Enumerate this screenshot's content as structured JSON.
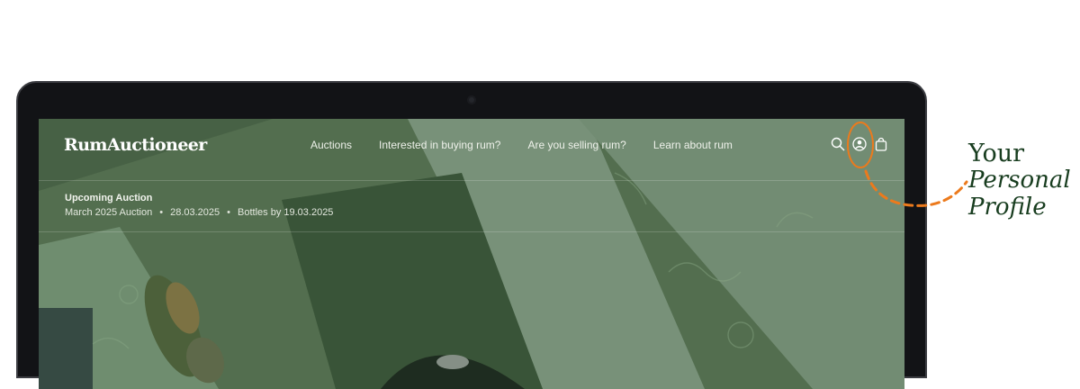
{
  "site": {
    "logo": "RumAuctioneer",
    "nav_items": [
      {
        "label": "Auctions"
      },
      {
        "label": "Interested in buying rum?"
      },
      {
        "label": "Are you selling rum?"
      },
      {
        "label": "Learn about rum"
      }
    ],
    "icons": [
      "search-icon",
      "user-profile-icon",
      "shopping-bag-icon"
    ]
  },
  "upcoming": {
    "label": "Upcoming Auction",
    "name": "March 2025 Auction",
    "separator": "•",
    "date": "28.03.2025",
    "bottles_by": "Bottles by 19.03.2025"
  },
  "callout": {
    "line1": "Your",
    "line2": "Personal",
    "line3": "Profile"
  },
  "colors": {
    "accent_orange": "#ec7a1c",
    "callout_green": "#183d1f",
    "header_bg": "#4d6a4b"
  }
}
